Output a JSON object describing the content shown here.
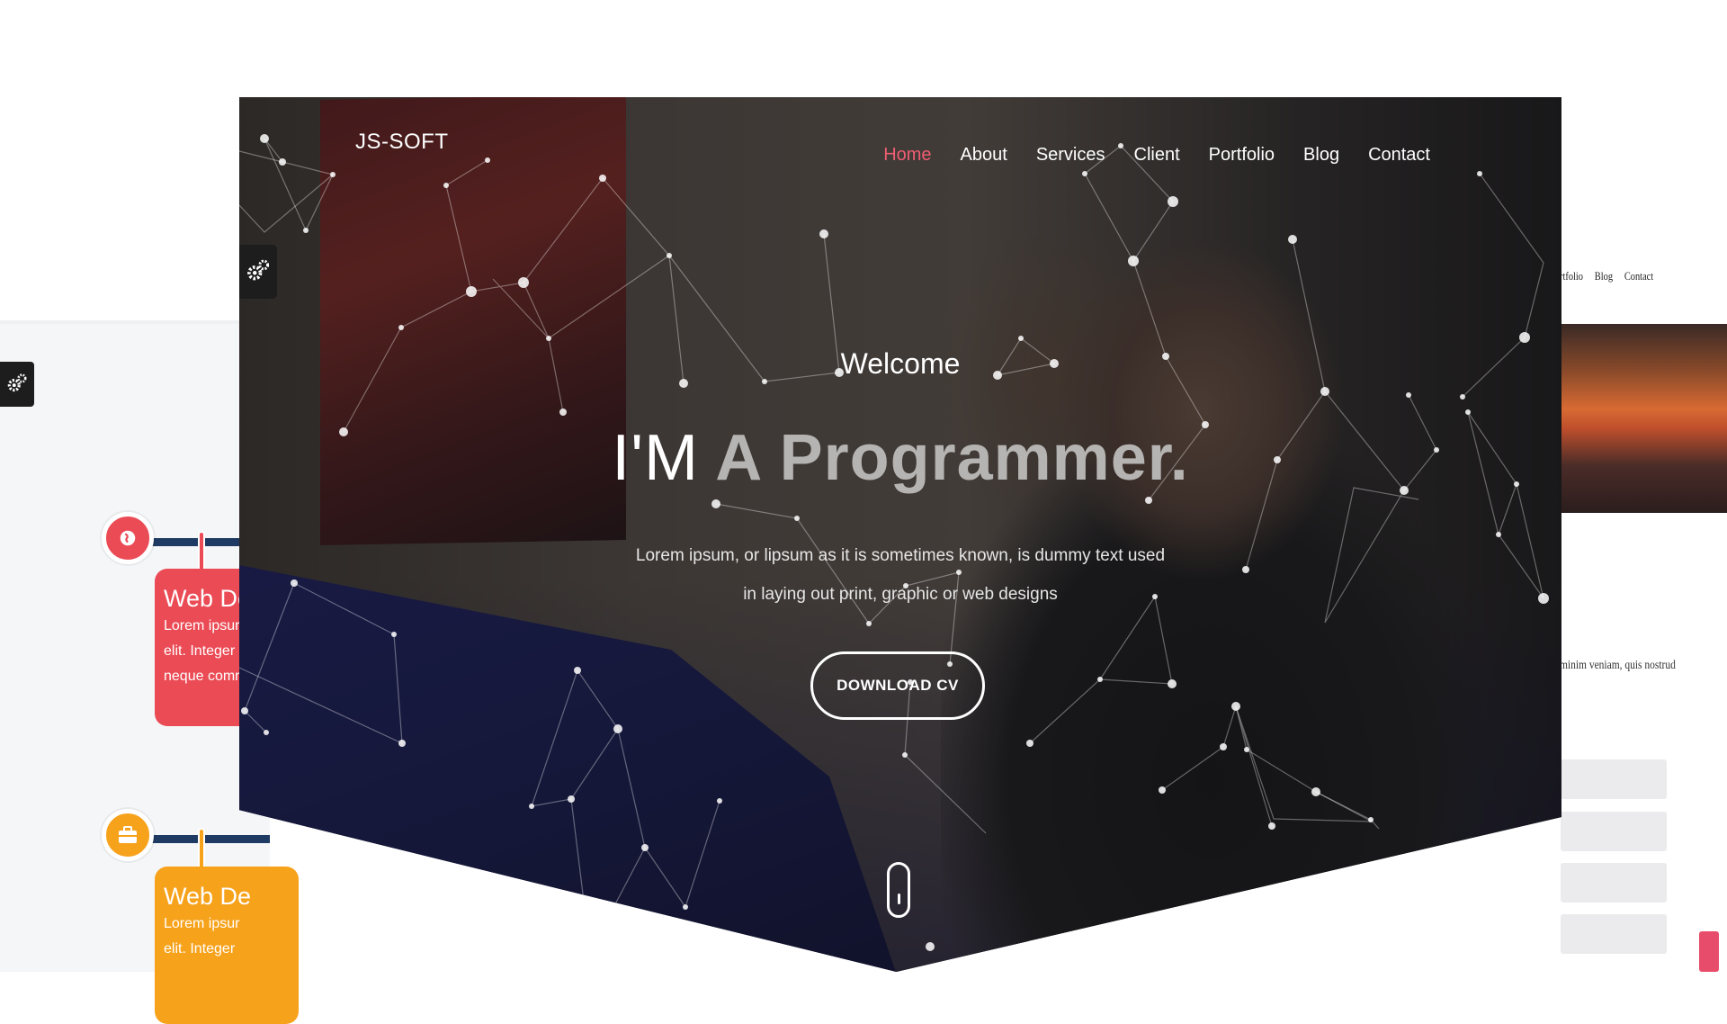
{
  "hero": {
    "logo": "JS-SOFT",
    "nav": [
      {
        "label": "Home",
        "active": true
      },
      {
        "label": "About",
        "active": false
      },
      {
        "label": "Services",
        "active": false
      },
      {
        "label": "Client",
        "active": false
      },
      {
        "label": "Portfolio",
        "active": false
      },
      {
        "label": "Blog",
        "active": false
      },
      {
        "label": "Contact",
        "active": false
      }
    ],
    "welcome": "Welcome",
    "headline_prefix": "I'M",
    "headline_highlight": "A Programmer.",
    "subtext_line1": "Lorem ipsum, or lipsum as it is sometimes known, is dummy text used",
    "subtext_line2": "in laying out print, graphic or web designs",
    "cta_label": "DOWNLOAD CV",
    "accent_color": "#ef5d72"
  },
  "left_panel": {
    "cards": [
      {
        "title": "Web De",
        "lines": [
          "Lorem ipsur",
          "elit. Integer",
          "neque comr"
        ],
        "color": "#eb4b55"
      },
      {
        "title": "Web De",
        "lines": [
          "Lorem ipsur",
          "elit. Integer"
        ],
        "color": "#f7a21b"
      }
    ]
  },
  "right_panel": {
    "nav": [
      "rtfolio",
      "Blog",
      "Contact"
    ],
    "text": "minim veniam, quis nostrud"
  }
}
